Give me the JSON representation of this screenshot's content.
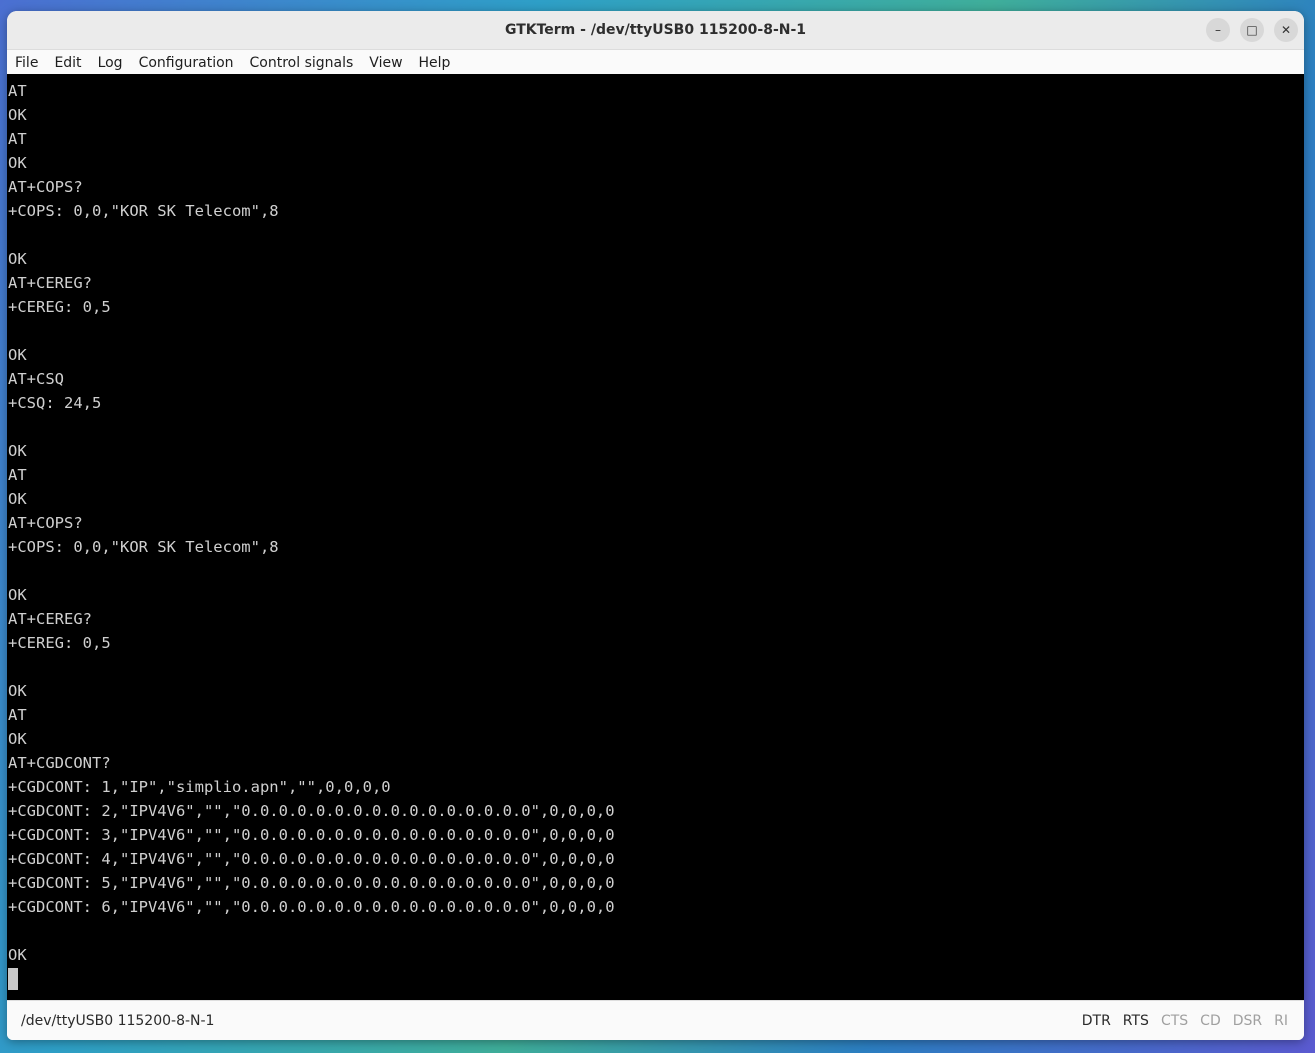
{
  "window": {
    "title": "GTKTerm - /dev/ttyUSB0  115200-8-N-1",
    "controls": {
      "minimize": "–",
      "maximize": "□",
      "close": "✕"
    }
  },
  "menubar": {
    "items": [
      "File",
      "Edit",
      "Log",
      "Configuration",
      "Control signals",
      "View",
      "Help"
    ]
  },
  "terminal": {
    "lines": [
      "AT",
      "OK",
      "AT",
      "OK",
      "AT+COPS?",
      "+COPS: 0,0,\"KOR SK Telecom\",8",
      "",
      "OK",
      "AT+CEREG?",
      "+CEREG: 0,5",
      "",
      "OK",
      "AT+CSQ",
      "+CSQ: 24,5",
      "",
      "OK",
      "AT",
      "OK",
      "AT+COPS?",
      "+COPS: 0,0,\"KOR SK Telecom\",8",
      "",
      "OK",
      "AT+CEREG?",
      "+CEREG: 0,5",
      "",
      "OK",
      "AT",
      "OK",
      "AT+CGDCONT?",
      "+CGDCONT: 1,\"IP\",\"simplio.apn\",\"\",0,0,0,0",
      "+CGDCONT: 2,\"IPV4V6\",\"\",\"0.0.0.0.0.0.0.0.0.0.0.0.0.0.0.0\",0,0,0,0",
      "+CGDCONT: 3,\"IPV4V6\",\"\",\"0.0.0.0.0.0.0.0.0.0.0.0.0.0.0.0\",0,0,0,0",
      "+CGDCONT: 4,\"IPV4V6\",\"\",\"0.0.0.0.0.0.0.0.0.0.0.0.0.0.0.0\",0,0,0,0",
      "+CGDCONT: 5,\"IPV4V6\",\"\",\"0.0.0.0.0.0.0.0.0.0.0.0.0.0.0.0\",0,0,0,0",
      "+CGDCONT: 6,\"IPV4V6\",\"\",\"0.0.0.0.0.0.0.0.0.0.0.0.0.0.0.0\",0,0,0,0",
      "",
      "OK"
    ]
  },
  "statusbar": {
    "port": "/dev/ttyUSB0  115200-8-N-1",
    "signals": [
      {
        "label": "DTR",
        "active": true
      },
      {
        "label": "RTS",
        "active": true
      },
      {
        "label": "CTS",
        "active": false
      },
      {
        "label": "CD",
        "active": false
      },
      {
        "label": "DSR",
        "active": false
      },
      {
        "label": "RI",
        "active": false
      }
    ]
  }
}
